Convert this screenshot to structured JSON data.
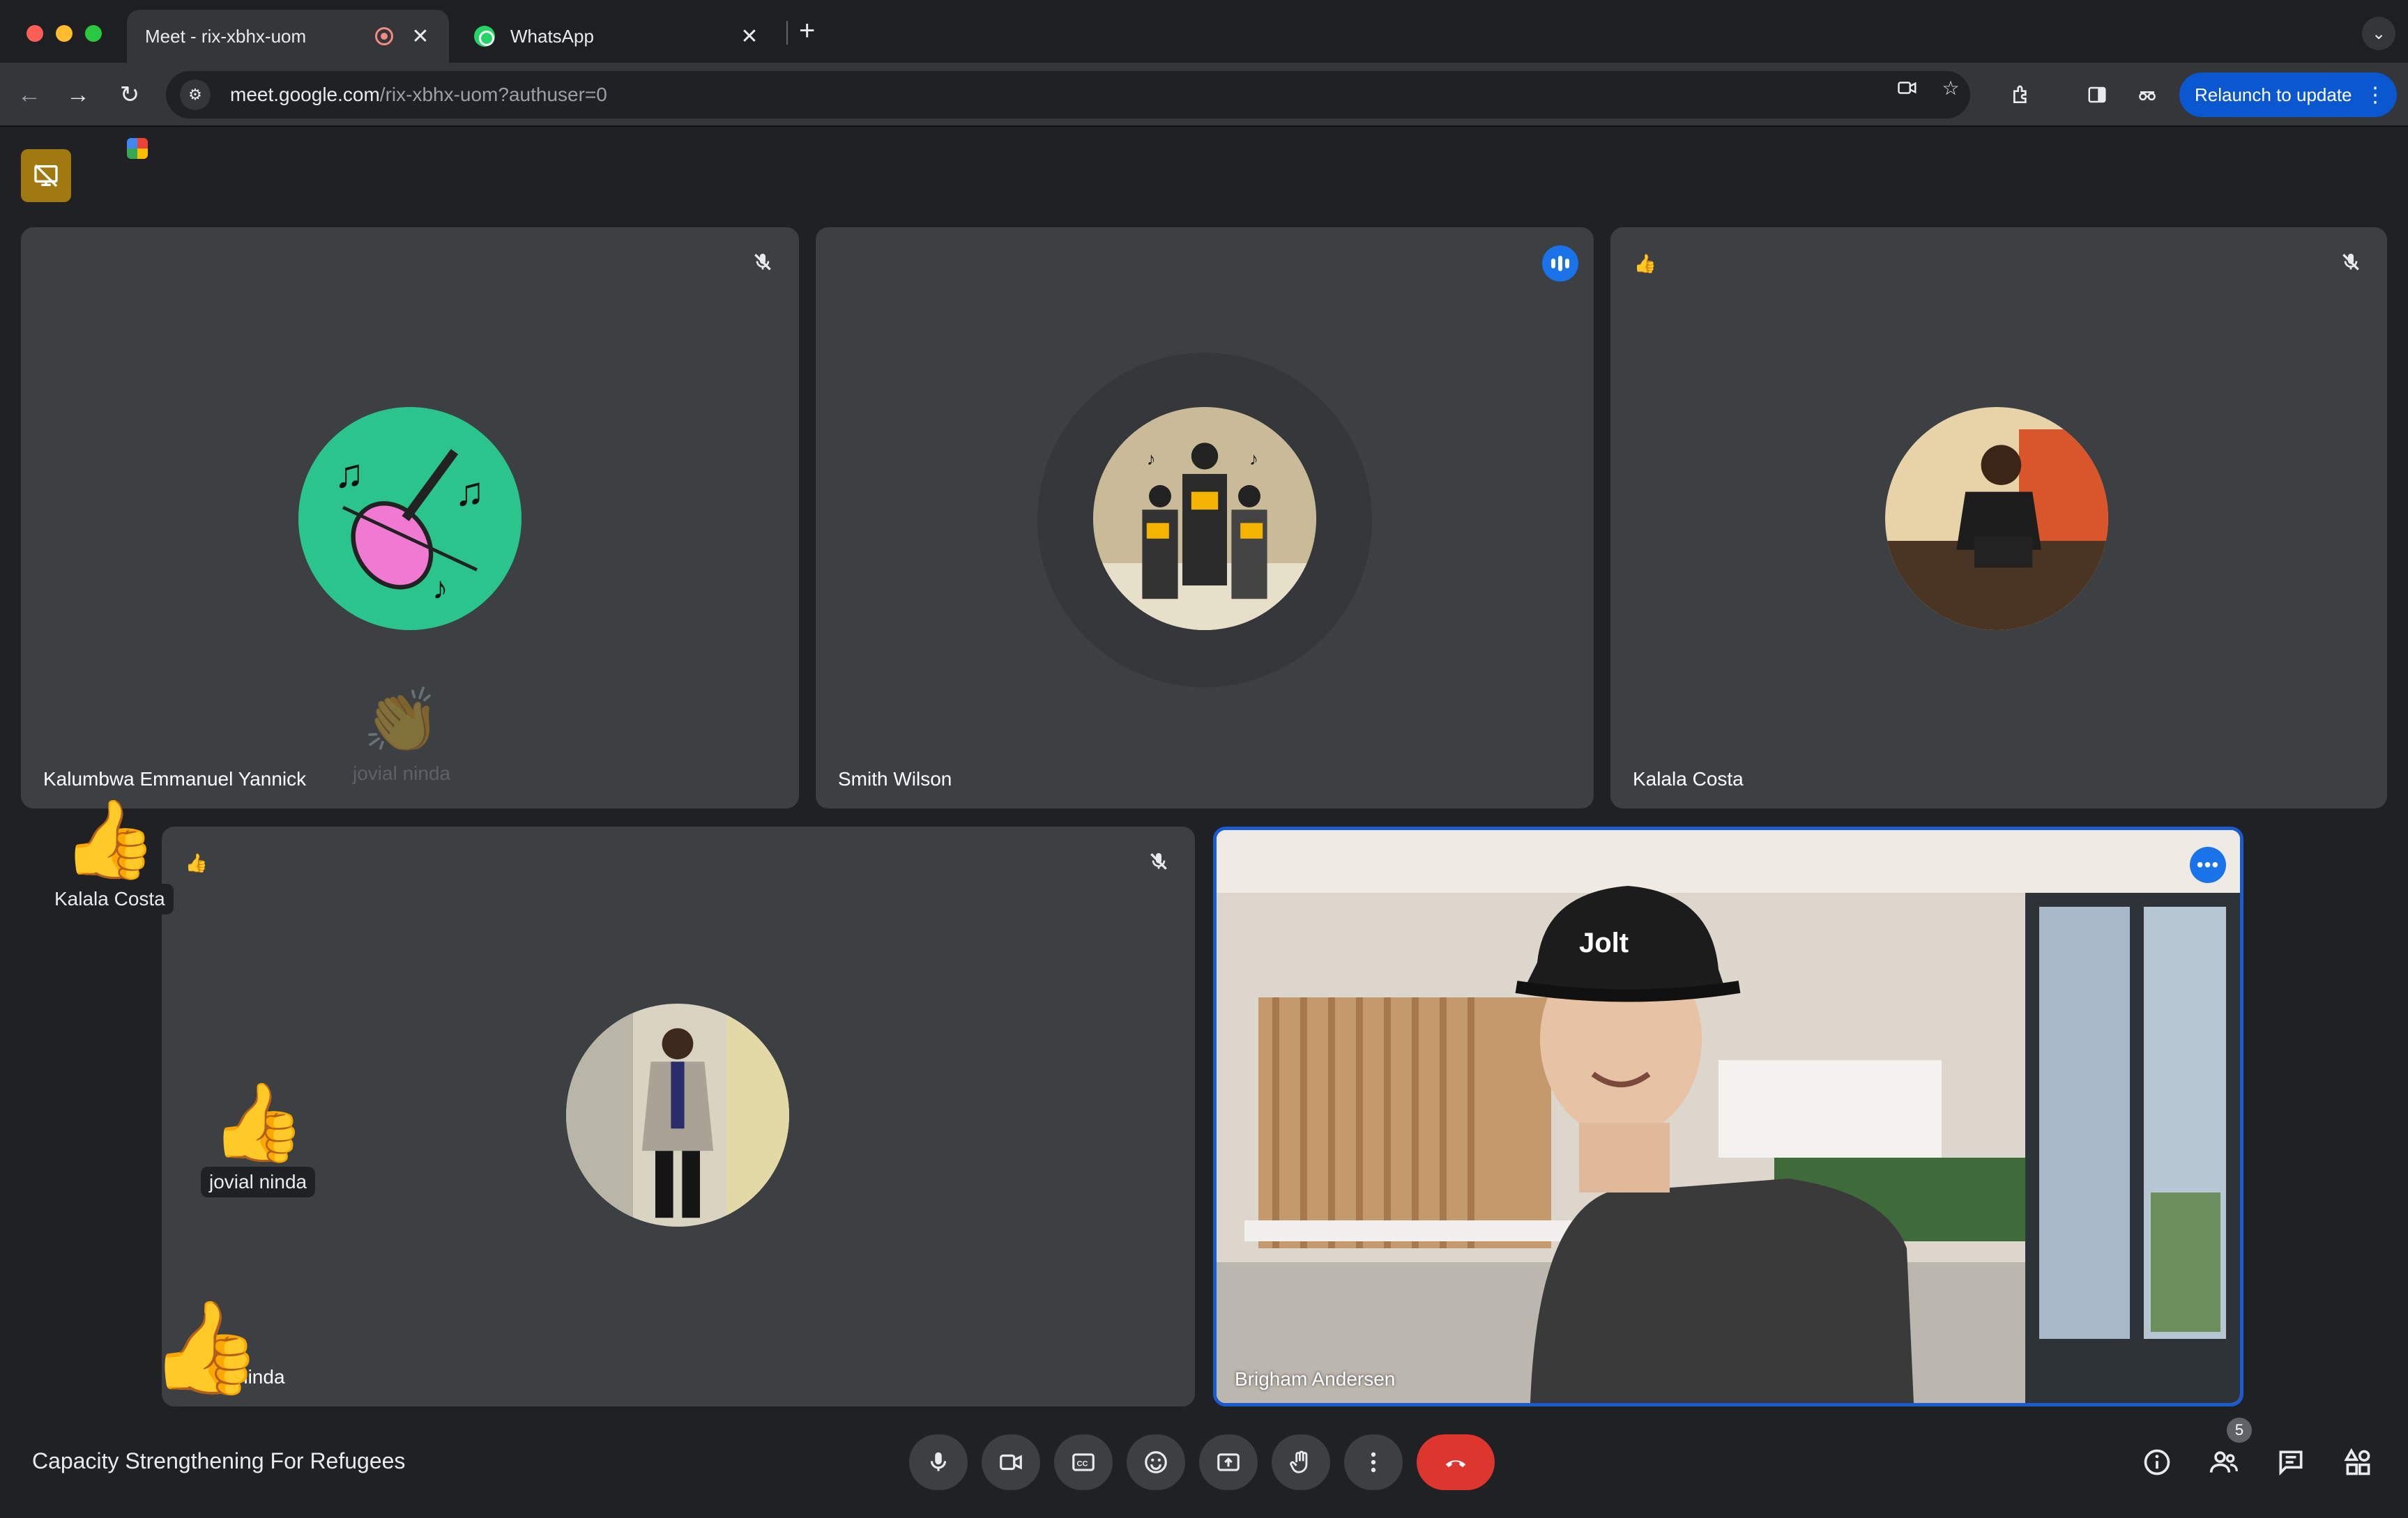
{
  "browser": {
    "tabs": [
      {
        "title": "Meet - rix-xbhx-uom",
        "active": true
      },
      {
        "title": "WhatsApp",
        "active": false
      }
    ],
    "url_host": "meet.google.com",
    "url_path": "/rix-xbhx-uom?authuser=0",
    "relaunch_label": "Relaunch to update",
    "close_glyph": "✕",
    "newtab_glyph": "+"
  },
  "meeting": {
    "title": "Capacity Strengthening For Refugees",
    "participant_count": "5"
  },
  "tiles": [
    {
      "name": "Kalumbwa Emmanuel Yannick",
      "muted": true,
      "avatar": "violin-icon"
    },
    {
      "name": "Smith Wilson",
      "speaking": true,
      "avatar": "choir-icon"
    },
    {
      "name": "Kalala Costa",
      "muted": true,
      "reaction": "👍",
      "avatar": "person-photo"
    },
    {
      "name": "jovial ninda",
      "muted": true,
      "reaction": "👍",
      "avatar": "person-photo"
    },
    {
      "name": "Brigham Andersen",
      "self": true
    }
  ],
  "reactions": [
    {
      "emoji": "👏",
      "who": "jovial ninda"
    },
    {
      "emoji": "👍",
      "who": "Kalala Costa"
    },
    {
      "emoji": "👍",
      "who": "jovial ninda"
    },
    {
      "emoji": "👍",
      "who": ""
    }
  ],
  "tile4_name_fragment": "ninda",
  "colors": {
    "accent": "#1a73e8",
    "hangup": "#dc362e",
    "tile": "#3c4043",
    "background": "#202124",
    "present_flag": "#a07a11"
  },
  "controls": [
    "microphone-icon",
    "camera-icon",
    "captions-icon",
    "emoji-icon",
    "present-icon",
    "raise-hand-icon",
    "more-options-icon",
    "hangup-icon"
  ],
  "side_controls": [
    "info-icon",
    "people-icon",
    "chat-icon",
    "activities-icon"
  ]
}
